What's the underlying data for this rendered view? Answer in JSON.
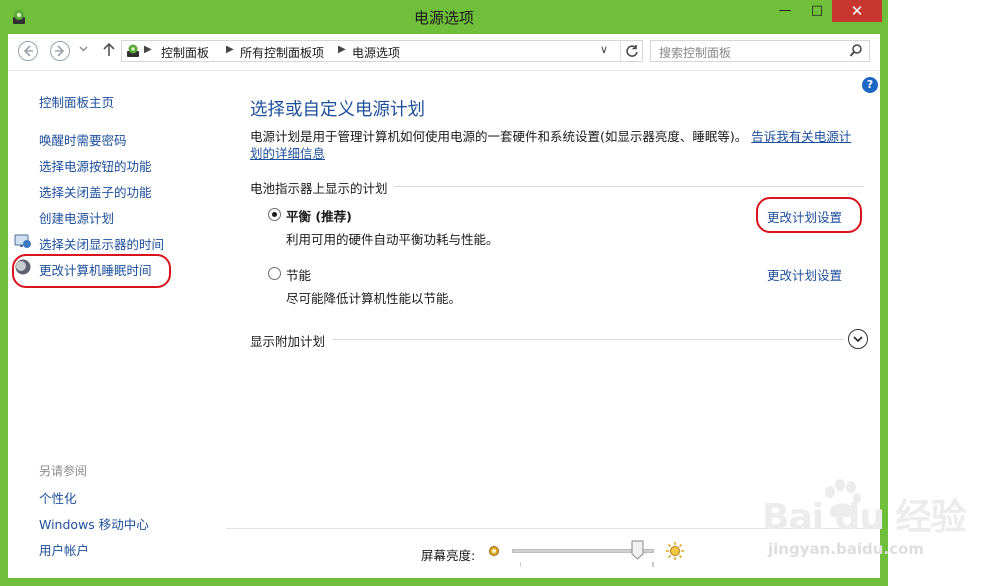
{
  "window": {
    "title": "电源选项",
    "buttons": {
      "minimize": "—",
      "maximize": "□",
      "close": "✕"
    }
  },
  "navbar": {
    "back_icon": "arrow-left-icon",
    "forward_icon": "arrow-right-icon",
    "recent_icon": "chevron-down-icon",
    "up_icon": "arrow-up-icon",
    "breadcrumb": [
      "控制面板",
      "所有控制面板项",
      "电源选项"
    ],
    "search_placeholder": "搜索控制面板"
  },
  "help": {
    "label": "?"
  },
  "sidebar": {
    "home": "控制面板主页",
    "items": [
      {
        "label": "唤醒时需要密码"
      },
      {
        "label": "选择电源按钮的功能"
      },
      {
        "label": "选择关闭盖子的功能"
      },
      {
        "label": "创建电源计划"
      },
      {
        "label": "选择关闭显示器的时间",
        "icon": "monitor-icon"
      },
      {
        "label": "更改计算机睡眠时间",
        "icon": "moon-icon"
      }
    ],
    "see_also_title": "另请参阅",
    "see_also": [
      {
        "label": "个性化"
      },
      {
        "label": "Windows 移动中心"
      },
      {
        "label": "用户帐户"
      }
    ]
  },
  "main": {
    "title": "选择或自定义电源计划",
    "description": "电源计划是用于管理计算机如何使用电源的一套硬件和系统设置(如显示器亮度、睡眠等)。",
    "description_link": "告诉我有关电源计划的详细信息",
    "battery_section": "电池指示器上显示的计划",
    "plans": [
      {
        "name": "平衡 (推荐)",
        "description": "利用可用的硬件自动平衡功耗与性能。",
        "link": "更改计划设置",
        "selected": true
      },
      {
        "name": "节能",
        "description": "尽可能降低计算机性能以节能。",
        "link": "更改计划设置",
        "selected": false
      }
    ],
    "extra_plans": "显示附加计划"
  },
  "brightness": {
    "label": "屏幕亮度:",
    "level_percent": 92
  },
  "watermark": {
    "brand": "Bai du 经验",
    "url": "jingyan.baidu.com"
  },
  "colors": {
    "window_border": "#6fbf3a",
    "link": "#1d4f9c",
    "close_button": "#c7372f",
    "annotation": "#d9141f"
  }
}
